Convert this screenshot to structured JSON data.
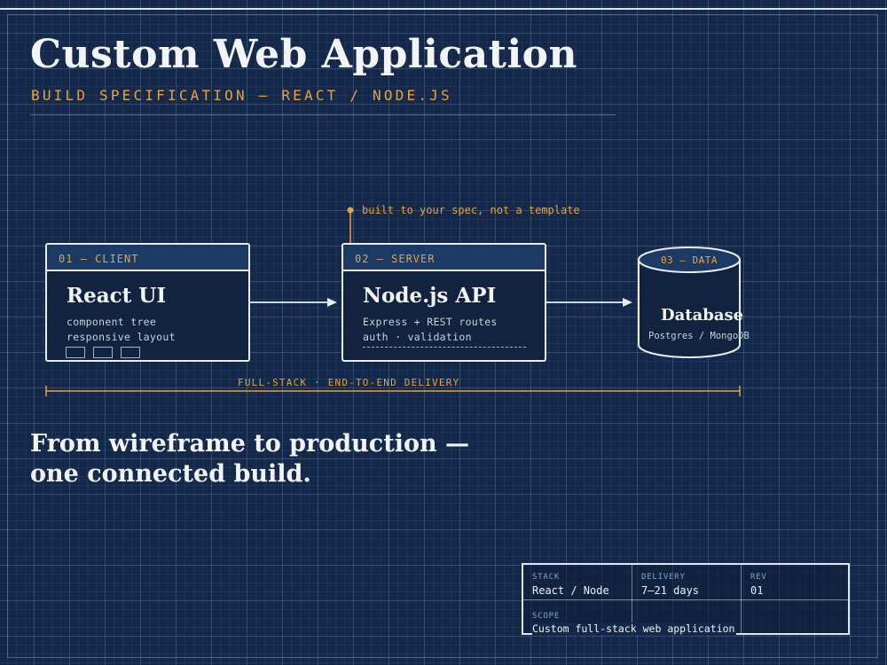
{
  "header": {
    "title": "Custom Web Application",
    "subtitle": "BUILD SPECIFICATION — REACT / NODE.JS"
  },
  "annotation": "built to your spec, not a template",
  "nodes": {
    "client": {
      "tag": "01 — CLIENT",
      "title": "React UI",
      "lines": [
        "component tree",
        "responsive layout"
      ]
    },
    "server": {
      "tag": "02 — SERVER",
      "title": "Node.js API",
      "lines": [
        "Express + REST routes",
        "auth · validation"
      ]
    },
    "data": {
      "tag": "03 — DATA",
      "title": "Database",
      "line": "Postgres / MongoDB"
    }
  },
  "span_label": "FULL-STACK · END-TO-END DELIVERY",
  "tagline": [
    "From wireframe to production —",
    "one connected build."
  ],
  "title_block": {
    "stack": {
      "label": "STACK",
      "value": "React / Node"
    },
    "delivery": {
      "label": "DELIVERY",
      "value": "7–21 days"
    },
    "rev": {
      "label": "REV",
      "value": "01"
    },
    "scope": {
      "label": "SCOPE",
      "value": "Custom full-stack web application"
    }
  },
  "colors": {
    "background": "#14284a",
    "accent": "#e7a23b",
    "line": "#e9eef6",
    "label_blue": "#7fa3cf"
  }
}
